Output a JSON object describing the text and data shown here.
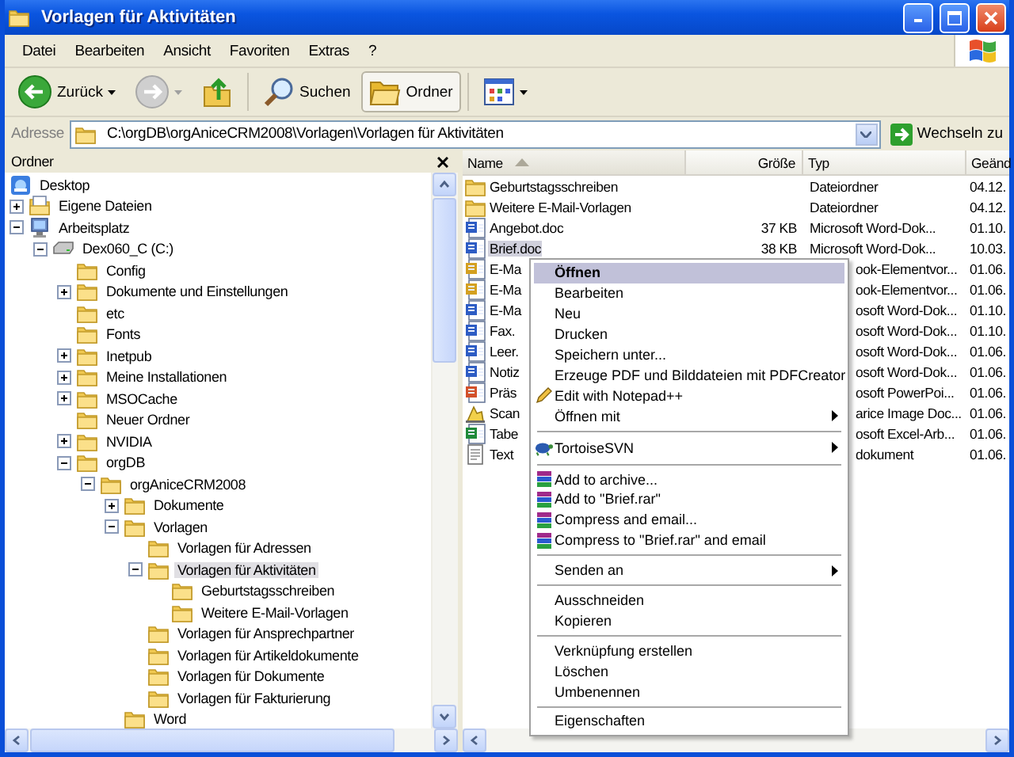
{
  "window": {
    "title": "Vorlagen für Aktivitäten"
  },
  "menu_bar": [
    "Datei",
    "Bearbeiten",
    "Ansicht",
    "Favoriten",
    "Extras",
    "?"
  ],
  "toolbar": [
    {
      "kind": "back",
      "label": "Zurück",
      "disabled": false
    },
    {
      "kind": "forward",
      "disabled": true
    },
    {
      "kind": "up"
    },
    {
      "kind": "search",
      "label": "Suchen",
      "pressed": false
    },
    {
      "kind": "folders",
      "label": "Ordner",
      "pressed": true
    },
    {
      "kind": "views"
    }
  ],
  "address_bar": {
    "label": "Adresse",
    "value": "C:\\orgDB\\orgAniceCRM2008\\Vorlagen\\Vorlagen für Aktivitäten",
    "go_button": "Wechseln zu"
  },
  "folder_pane": {
    "title": "Ordner",
    "tree": [
      {
        "label": "Desktop",
        "kind": "desktop",
        "selected": false,
        "children": [
          {
            "label": "Eigene Dateien",
            "kind": "documents",
            "expanded": false,
            "selected": false
          },
          {
            "label": "Arbeitsplatz",
            "kind": "computer",
            "expanded": true,
            "selected": false,
            "children": [
              {
                "label": "Dex060_C (C:)",
                "kind": "drive",
                "expanded": true,
                "selected": false,
                "children": [
                  {
                    "label": "Config",
                    "kind": "folder",
                    "selected": false
                  },
                  {
                    "label": "Dokumente und Einstellungen",
                    "kind": "folder",
                    "expanded": false,
                    "selected": false
                  },
                  {
                    "label": "etc",
                    "kind": "folder",
                    "selected": false
                  },
                  {
                    "label": "Fonts",
                    "kind": "folder",
                    "selected": false
                  },
                  {
                    "label": "Inetpub",
                    "kind": "folder",
                    "expanded": false,
                    "selected": false
                  },
                  {
                    "label": "Meine Installationen",
                    "kind": "folder",
                    "expanded": false,
                    "selected": false
                  },
                  {
                    "label": "MSOCache",
                    "kind": "folder",
                    "expanded": false,
                    "selected": false
                  },
                  {
                    "label": "Neuer Ordner",
                    "kind": "folder",
                    "selected": false
                  },
                  {
                    "label": "NVIDIA",
                    "kind": "folder",
                    "expanded": false,
                    "selected": false
                  },
                  {
                    "label": "orgDB",
                    "kind": "folder",
                    "expanded": true,
                    "selected": false,
                    "children": [
                      {
                        "label": "orgAniceCRM2008",
                        "kind": "folder",
                        "expanded": true,
                        "selected": false,
                        "children": [
                          {
                            "label": "Dokumente",
                            "kind": "folder",
                            "expanded": false,
                            "selected": false
                          },
                          {
                            "label": "Vorlagen",
                            "kind": "folder",
                            "expanded": true,
                            "selected": false,
                            "children": [
                              {
                                "label": "Vorlagen für Adressen",
                                "kind": "folder",
                                "selected": false
                              },
                              {
                                "label": "Vorlagen für Aktivitäten",
                                "kind": "folder",
                                "expanded": true,
                                "selected": true,
                                "children": [
                                  {
                                    "label": "Geburtstagsschreiben",
                                    "kind": "folder",
                                    "selected": false
                                  },
                                  {
                                    "label": "Weitere E-Mail-Vorlagen",
                                    "kind": "folder",
                                    "selected": false
                                  }
                                ]
                              },
                              {
                                "label": "Vorlagen für Ansprechpartner",
                                "kind": "folder",
                                "selected": false
                              },
                              {
                                "label": "Vorlagen für Artikeldokumente",
                                "kind": "folder",
                                "selected": false
                              },
                              {
                                "label": "Vorlagen für Dokumente",
                                "kind": "folder",
                                "selected": false
                              },
                              {
                                "label": "Vorlagen für Fakturierung",
                                "kind": "folder",
                                "selected": false
                              }
                            ]
                          },
                          {
                            "label": "Word",
                            "kind": "folder",
                            "selected": false
                          }
                        ]
                      }
                    ]
                  }
                ]
              }
            ]
          }
        ]
      }
    ]
  },
  "file_list": {
    "columns": [
      {
        "label": "Name",
        "sorted": true
      },
      {
        "label": "Größe",
        "sorted": false
      },
      {
        "label": "Typ",
        "sorted": false
      },
      {
        "label": "Geänd",
        "sorted": false
      }
    ],
    "rows": [
      {
        "kind": "folder",
        "name": "Geburtstagsschreiben",
        "type": "Dateiordner",
        "date": "04.12.",
        "selected": false
      },
      {
        "kind": "folder",
        "name": "Weitere E-Mail-Vorlagen",
        "type": "Dateiordner",
        "date": "04.12.",
        "selected": false
      },
      {
        "kind": "word",
        "name": "Angebot.doc",
        "size": "37 KB",
        "type": "Microsoft Word-Dok...",
        "date": "01.10.",
        "selected": false
      },
      {
        "kind": "word",
        "name": "Brief.doc",
        "size": "38 KB",
        "type": "Microsoft Word-Dok...",
        "date": "10.03.",
        "selected": true
      },
      {
        "kind": "mail",
        "name": "E-Ma",
        "type": "ook-Elementvor...",
        "date": "01.06.",
        "selected": false
      },
      {
        "kind": "mail",
        "name": "E-Ma",
        "type": "ook-Elementvor...",
        "date": "01.06.",
        "selected": false
      },
      {
        "kind": "word",
        "name": "E-Ma",
        "type": "osoft Word-Dok...",
        "date": "01.10.",
        "selected": false
      },
      {
        "kind": "word",
        "name": "Fax.",
        "type": "osoft Word-Dok...",
        "date": "01.10.",
        "selected": false
      },
      {
        "kind": "word",
        "name": "Leer.",
        "type": "osoft Word-Dok...",
        "date": "01.06.",
        "selected": false
      },
      {
        "kind": "word",
        "name": "Notiz",
        "type": "osoft Word-Dok...",
        "date": "01.06.",
        "selected": false
      },
      {
        "kind": "slides",
        "name": "Präs",
        "type": "osoft PowerPoi...",
        "date": "01.06.",
        "selected": false
      },
      {
        "kind": "image",
        "name": "Scan",
        "type": "arice Image Doc...",
        "date": "01.06.",
        "selected": false
      },
      {
        "kind": "sheet",
        "name": "Tabe",
        "type": "osoft Excel-Arb...",
        "date": "01.06.",
        "selected": false
      },
      {
        "kind": "text",
        "name": "Text",
        "type": "dokument",
        "date": "01.06.",
        "selected": false
      }
    ]
  },
  "context_menu": [
    {
      "kind": "plain",
      "label": "Öffnen",
      "default": true,
      "selected": true
    },
    {
      "kind": "plain",
      "label": "Bearbeiten",
      "selected": false
    },
    {
      "kind": "plain",
      "label": "Neu",
      "selected": false
    },
    {
      "kind": "plain",
      "label": "Drucken",
      "selected": false
    },
    {
      "kind": "plain",
      "label": "Speichern unter...",
      "selected": false
    },
    {
      "kind": "plain",
      "label": "Erzeuge PDF und Bilddateien mit PDFCreator",
      "selected": false
    },
    {
      "kind": "notepad",
      "label": "Edit with Notepad++",
      "selected": false
    },
    {
      "kind": "plain",
      "label": "Öffnen mit",
      "submenu": true,
      "selected": false
    },
    {
      "kind": "separator"
    },
    {
      "kind": "svn",
      "label": "TortoiseSVN",
      "submenu": true,
      "selected": false
    },
    {
      "kind": "separator"
    },
    {
      "kind": "archive",
      "label": "Add to archive...",
      "selected": false
    },
    {
      "kind": "archive",
      "label": "Add to \"Brief.rar\"",
      "selected": false
    },
    {
      "kind": "archive",
      "label": "Compress and email...",
      "selected": false
    },
    {
      "kind": "archive",
      "label": "Compress to \"Brief.rar\" and email",
      "selected": false
    },
    {
      "kind": "separator"
    },
    {
      "kind": "plain",
      "label": "Senden an",
      "submenu": true,
      "selected": false
    },
    {
      "kind": "separator"
    },
    {
      "kind": "plain",
      "label": "Ausschneiden",
      "selected": false
    },
    {
      "kind": "plain",
      "label": "Kopieren",
      "selected": false
    },
    {
      "kind": "separator"
    },
    {
      "kind": "plain",
      "label": "Verknüpfung erstellen",
      "selected": false
    },
    {
      "kind": "plain",
      "label": "Löschen",
      "selected": false
    },
    {
      "kind": "plain",
      "label": "Umbenennen",
      "selected": false
    },
    {
      "kind": "separator"
    },
    {
      "kind": "plain",
      "label": "Eigenschaften",
      "selected": false
    }
  ]
}
